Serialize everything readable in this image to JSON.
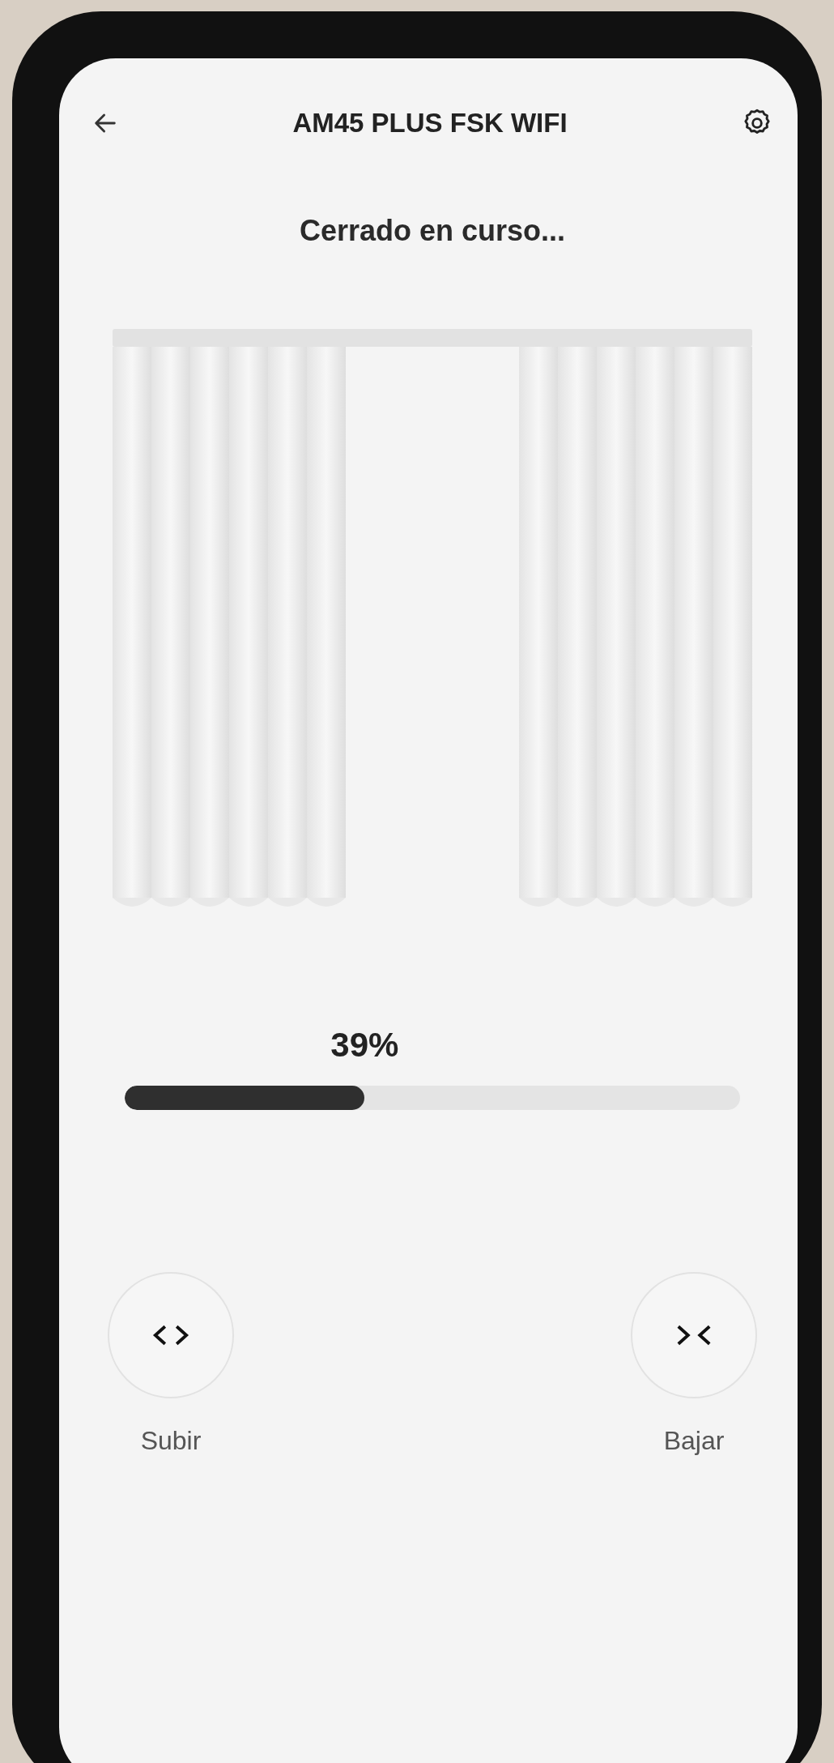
{
  "header": {
    "title": "AM45 PLUS FSK WIFI"
  },
  "status": "Cerrado en curso...",
  "position": {
    "reading": "39%",
    "level": 0.39
  },
  "controls": [
    {
      "kind": "open",
      "label": "Subir"
    },
    {
      "kind": "close",
      "label": "Bajar"
    }
  ]
}
